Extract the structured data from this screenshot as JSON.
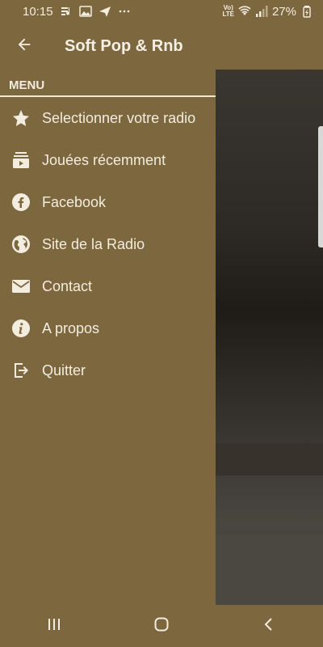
{
  "status_bar": {
    "time": "10:15",
    "battery": "27%",
    "volte": "Vo)) LTE"
  },
  "app_bar": {
    "title": "Soft Pop & Rnb",
    "back_icon": "arrow-left-icon"
  },
  "drawer": {
    "header": "MENU",
    "items": [
      {
        "label": "Selectionner votre radio",
        "icon": "star-icon"
      },
      {
        "label": "Jouées récemment",
        "icon": "playlist-icon"
      },
      {
        "label": "Facebook",
        "icon": "facebook-icon"
      },
      {
        "label": "Site de la Radio",
        "icon": "globe-icon"
      },
      {
        "label": "Contact",
        "icon": "mail-icon"
      },
      {
        "label": "A propos",
        "icon": "info-icon"
      },
      {
        "label": "Quitter",
        "icon": "exit-icon"
      }
    ]
  },
  "colors": {
    "primary": "#7c673f",
    "text": "#f3ede0"
  }
}
